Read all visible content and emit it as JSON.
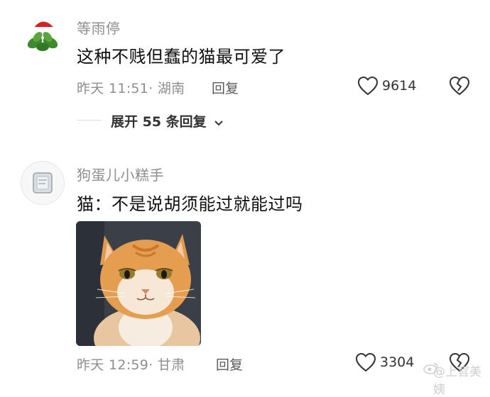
{
  "comments": [
    {
      "username": "等雨停",
      "text": "这种不贱但蠢的猫最可爱了",
      "meta": "昨天 11:51· 湖南",
      "reply_label": "回复",
      "likes": "9614",
      "expand_label": "展开 55 条回复"
    },
    {
      "username": "狗蛋儿小糕手",
      "text": "猫：不是说胡须能过就能过吗",
      "meta": "昨天 12:59· 甘肃",
      "reply_label": "回复",
      "likes": "3304"
    }
  ],
  "watermark": {
    "text": "@上官美姨"
  },
  "icons": {
    "like": "heart-outline-icon",
    "dislike": "broken-heart-icon",
    "expand": "chevron-down-icon",
    "weibo": "weibo-logo-icon"
  },
  "colors": {
    "text_primary": "#111111",
    "text_secondary": "#8e8e8e",
    "divider": "#dcdcdc"
  }
}
